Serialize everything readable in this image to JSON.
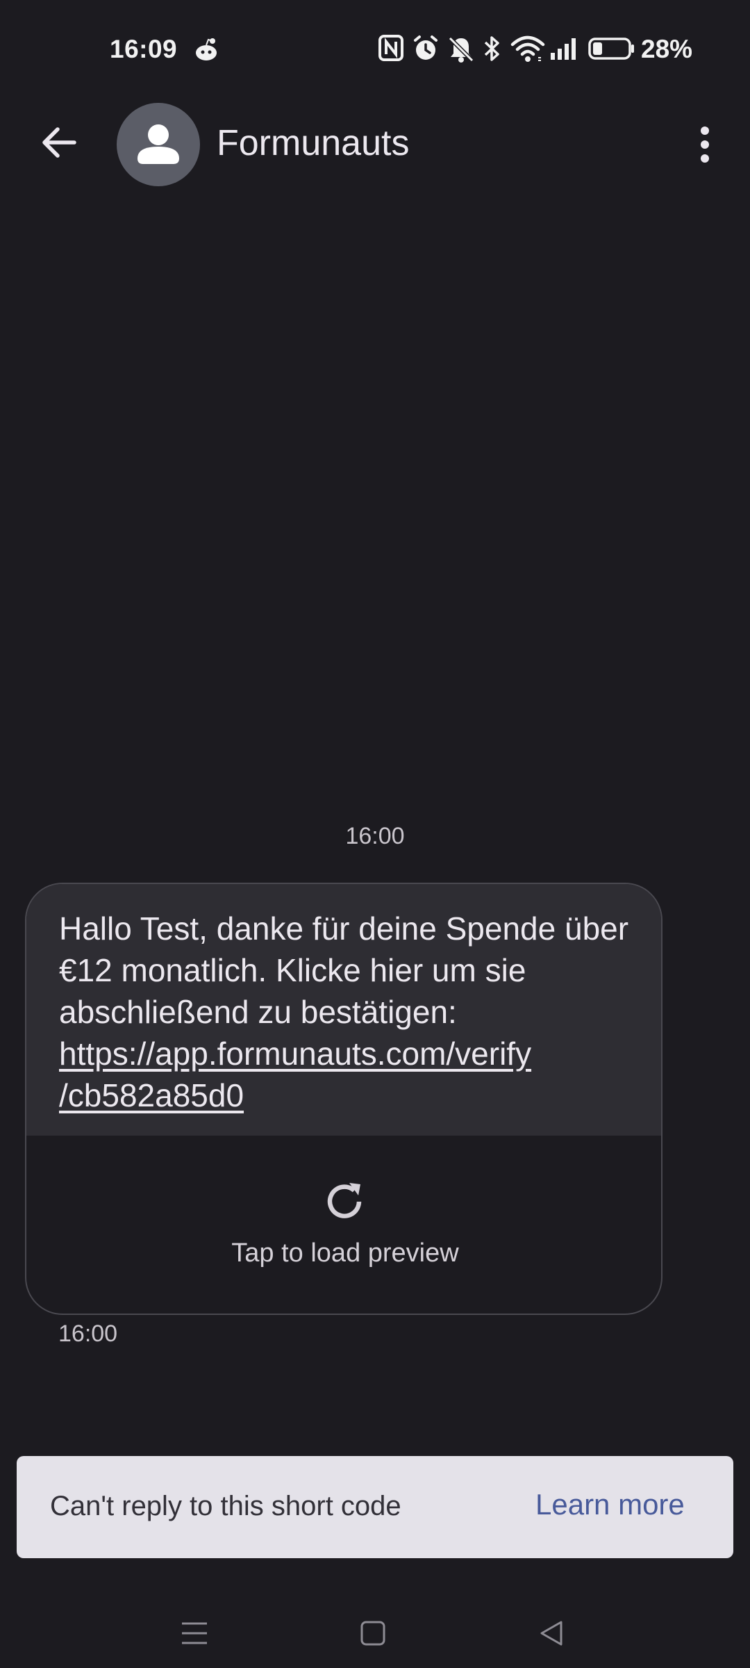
{
  "status_bar": {
    "time": "16:09",
    "battery_percent": "28%",
    "icons": [
      "reddit-icon",
      "nfc-icon",
      "alarm-icon",
      "mute-icon",
      "bluetooth-icon",
      "wifi-icon",
      "signal-icon",
      "battery-icon"
    ],
    "battery_level": 0.28
  },
  "app_bar": {
    "contact_name": "Formunauts",
    "back_icon": "arrow-left-icon",
    "more_icon": "more-vert-icon"
  },
  "conversation": {
    "timestamp_header": "16:00",
    "message": {
      "text": "Hallo Test, danke für deine Spende über €12 monatlich. Klicke hier um sie abschließend zu bestätigen:",
      "link": "https://app.formunauts.com/verify/cb582a85d0",
      "link_line1": "https://app.formunauts.com/verify",
      "link_line2": "/cb582a85d0"
    },
    "preview_label": "Tap to load preview",
    "timestamp_footer": "16:00"
  },
  "banner": {
    "text": "Can't reply to this short code",
    "action": "Learn more"
  },
  "colors": {
    "background": "#1c1b20",
    "bubble": "#2e2d33",
    "banner": "#e4e2e9",
    "accent": "#485a9a"
  }
}
